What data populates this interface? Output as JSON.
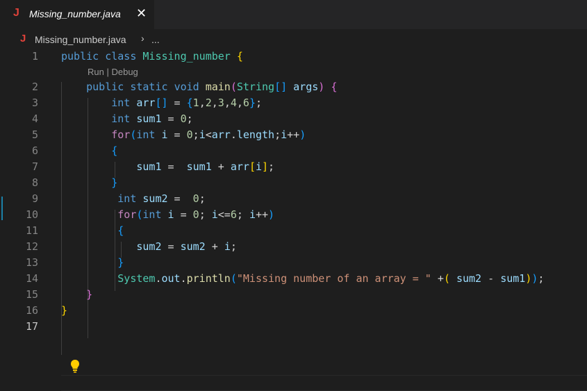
{
  "tab": {
    "icon": "J",
    "title": "Missing_number.java",
    "close": "✕"
  },
  "breadcrumb": {
    "icon": "J",
    "file": "Missing_number.java",
    "separator": "›",
    "more": "..."
  },
  "codelens": {
    "run": "Run",
    "sep": " | ",
    "debug": "Debug"
  },
  "icons": {
    "file_icon": "java-file-icon",
    "close_icon": "close-icon",
    "lightbulb_icon": "lightbulb-icon"
  },
  "colors": {
    "keyword": "#569cd6",
    "control": "#c586c0",
    "class": "#4ec9b0",
    "function": "#dcdcaa",
    "variable": "#9cdcfe",
    "number": "#b5cea8",
    "string": "#ce9178",
    "plain": "#d4d4d4",
    "bracket1": "#ffd700",
    "bracket2": "#da70d6",
    "bracket3": "#179fff"
  },
  "lines": [
    {
      "n": "1",
      "tokens": [
        [
          "public",
          "keyword"
        ],
        [
          " ",
          "plain"
        ],
        [
          "class",
          "keyword"
        ],
        [
          " ",
          "plain"
        ],
        [
          "Missing_number",
          "class"
        ],
        [
          " ",
          "plain"
        ],
        [
          "{",
          "bracket1"
        ]
      ]
    },
    {
      "n": "2",
      "tokens": [
        [
          "    ",
          "plain"
        ],
        [
          "public",
          "keyword"
        ],
        [
          " ",
          "plain"
        ],
        [
          "static",
          "keyword"
        ],
        [
          " ",
          "plain"
        ],
        [
          "void",
          "keyword"
        ],
        [
          " ",
          "plain"
        ],
        [
          "main",
          "function"
        ],
        [
          "(",
          "bracket2"
        ],
        [
          "String",
          "class"
        ],
        [
          "[]",
          "bracket3"
        ],
        [
          " ",
          "plain"
        ],
        [
          "args",
          "variable"
        ],
        [
          ")",
          "bracket2"
        ],
        [
          " ",
          "plain"
        ],
        [
          "{",
          "bracket2"
        ]
      ]
    },
    {
      "n": "3",
      "tokens": [
        [
          "        ",
          "plain"
        ],
        [
          "int",
          "keyword"
        ],
        [
          " ",
          "plain"
        ],
        [
          "arr",
          "variable"
        ],
        [
          "[]",
          "bracket3"
        ],
        [
          " = ",
          "plain"
        ],
        [
          "{",
          "bracket3"
        ],
        [
          "1",
          "number"
        ],
        [
          ",",
          "plain"
        ],
        [
          "2",
          "number"
        ],
        [
          ",",
          "plain"
        ],
        [
          "3",
          "number"
        ],
        [
          ",",
          "plain"
        ],
        [
          "4",
          "number"
        ],
        [
          ",",
          "plain"
        ],
        [
          "6",
          "number"
        ],
        [
          "}",
          "bracket3"
        ],
        [
          ";",
          "plain"
        ]
      ]
    },
    {
      "n": "4",
      "tokens": [
        [
          "        ",
          "plain"
        ],
        [
          "int",
          "keyword"
        ],
        [
          " ",
          "plain"
        ],
        [
          "sum1",
          "variable"
        ],
        [
          " = ",
          "plain"
        ],
        [
          "0",
          "number"
        ],
        [
          ";",
          "plain"
        ]
      ]
    },
    {
      "n": "5",
      "tokens": [
        [
          "        ",
          "plain"
        ],
        [
          "for",
          "control"
        ],
        [
          "(",
          "bracket3"
        ],
        [
          "int",
          "keyword"
        ],
        [
          " ",
          "plain"
        ],
        [
          "i",
          "variable"
        ],
        [
          " = ",
          "plain"
        ],
        [
          "0",
          "number"
        ],
        [
          ";",
          "plain"
        ],
        [
          "i",
          "variable"
        ],
        [
          "<",
          "plain"
        ],
        [
          "arr",
          "variable"
        ],
        [
          ".",
          "plain"
        ],
        [
          "length",
          "variable"
        ],
        [
          ";",
          "plain"
        ],
        [
          "i",
          "variable"
        ],
        [
          "++",
          "plain"
        ],
        [
          ")",
          "bracket3"
        ]
      ]
    },
    {
      "n": "6",
      "tokens": [
        [
          "        ",
          "plain"
        ],
        [
          "{",
          "bracket3"
        ]
      ]
    },
    {
      "n": "7",
      "tokens": [
        [
          "            ",
          "plain"
        ],
        [
          "sum1",
          "variable"
        ],
        [
          " =  ",
          "plain"
        ],
        [
          "sum1",
          "variable"
        ],
        [
          " + ",
          "plain"
        ],
        [
          "arr",
          "variable"
        ],
        [
          "[",
          "bracket1"
        ],
        [
          "i",
          "variable"
        ],
        [
          "]",
          "bracket1"
        ],
        [
          ";",
          "plain"
        ]
      ]
    },
    {
      "n": "8",
      "tokens": [
        [
          "        ",
          "plain"
        ],
        [
          "}",
          "bracket3"
        ]
      ]
    },
    {
      "n": "9",
      "tokens": [
        [
          "         ",
          "plain"
        ],
        [
          "int",
          "keyword"
        ],
        [
          " ",
          "plain"
        ],
        [
          "sum2",
          "variable"
        ],
        [
          " =  ",
          "plain"
        ],
        [
          "0",
          "number"
        ],
        [
          ";",
          "plain"
        ]
      ]
    },
    {
      "n": "10",
      "tokens": [
        [
          "         ",
          "plain"
        ],
        [
          "for",
          "control"
        ],
        [
          "(",
          "bracket3"
        ],
        [
          "int",
          "keyword"
        ],
        [
          " ",
          "plain"
        ],
        [
          "i",
          "variable"
        ],
        [
          " = ",
          "plain"
        ],
        [
          "0",
          "number"
        ],
        [
          "; ",
          "plain"
        ],
        [
          "i",
          "variable"
        ],
        [
          "<=",
          "plain"
        ],
        [
          "6",
          "number"
        ],
        [
          "; ",
          "plain"
        ],
        [
          "i",
          "variable"
        ],
        [
          "++",
          "plain"
        ],
        [
          ")",
          "bracket3"
        ]
      ]
    },
    {
      "n": "11",
      "tokens": [
        [
          "         ",
          "plain"
        ],
        [
          "{",
          "bracket3"
        ]
      ]
    },
    {
      "n": "12",
      "tokens": [
        [
          "            ",
          "plain"
        ],
        [
          "sum2",
          "variable"
        ],
        [
          " = ",
          "plain"
        ],
        [
          "sum2",
          "variable"
        ],
        [
          " + ",
          "plain"
        ],
        [
          "i",
          "variable"
        ],
        [
          ";",
          "plain"
        ]
      ]
    },
    {
      "n": "13",
      "tokens": [
        [
          "         ",
          "plain"
        ],
        [
          "}",
          "bracket3"
        ]
      ]
    },
    {
      "n": "14",
      "tokens": [
        [
          "         ",
          "plain"
        ],
        [
          "System",
          "class"
        ],
        [
          ".",
          "plain"
        ],
        [
          "out",
          "variable"
        ],
        [
          ".",
          "plain"
        ],
        [
          "println",
          "function"
        ],
        [
          "(",
          "bracket3"
        ],
        [
          "\"Missing number of an array = \"",
          "string"
        ],
        [
          " +",
          "plain"
        ],
        [
          "(",
          "bracket1"
        ],
        [
          " ",
          "plain"
        ],
        [
          "sum2",
          "variable"
        ],
        [
          " - ",
          "plain"
        ],
        [
          "sum1",
          "variable"
        ],
        [
          ")",
          "bracket1"
        ],
        [
          ")",
          "bracket3"
        ],
        [
          ";",
          "plain"
        ]
      ]
    },
    {
      "n": "15",
      "tokens": [
        [
          "    ",
          "plain"
        ],
        [
          "}",
          "bracket2"
        ]
      ]
    },
    {
      "n": "16",
      "tokens": [
        [
          "}",
          "bracket1"
        ]
      ]
    },
    {
      "n": "17",
      "tokens": []
    }
  ]
}
